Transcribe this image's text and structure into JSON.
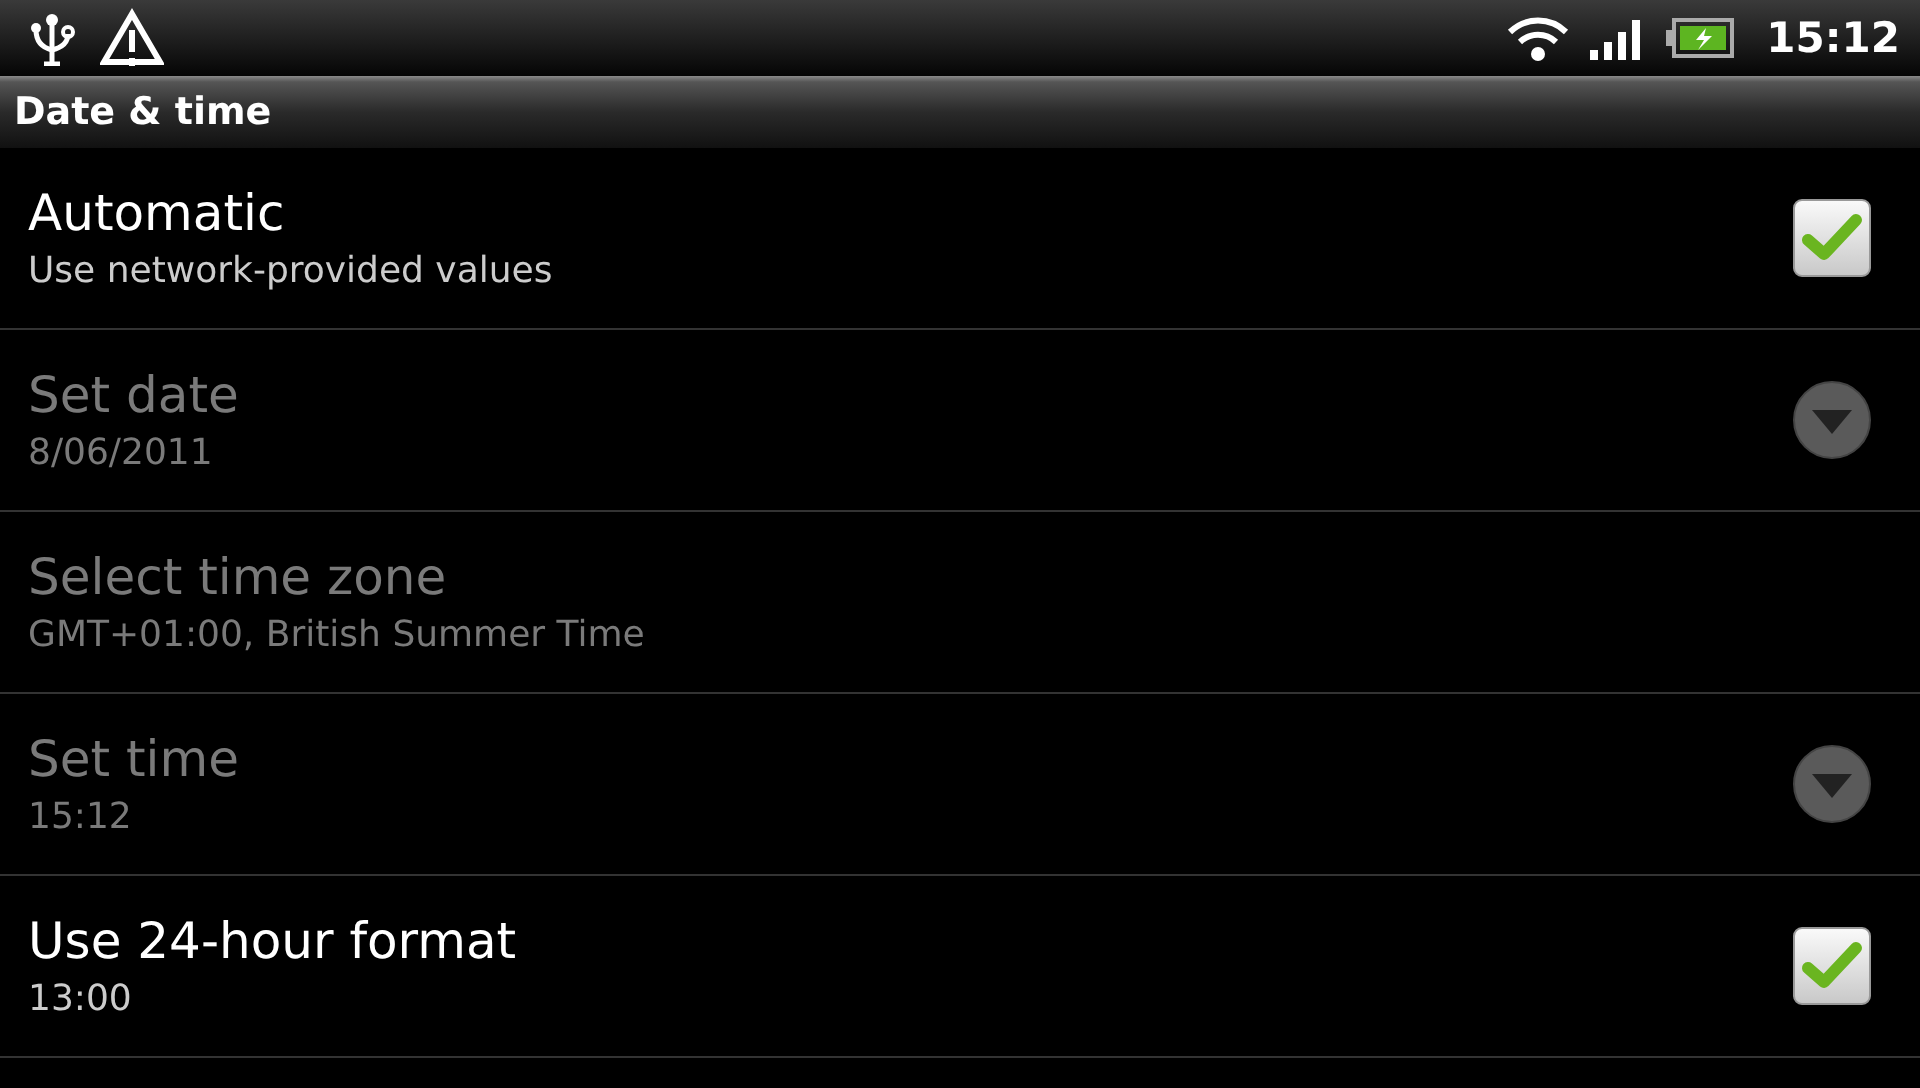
{
  "status_bar": {
    "time": "15:12"
  },
  "header": {
    "title": "Date & time"
  },
  "settings": [
    {
      "kind": "checkbox",
      "title": "Automatic",
      "summary": "Use network-provided values",
      "disabled": false,
      "checked": true
    },
    {
      "kind": "dropdown",
      "title": "Set date",
      "summary": "8/06/2011",
      "disabled": true
    },
    {
      "kind": "plain",
      "title": "Select time zone",
      "summary": "GMT+01:00, British Summer Time",
      "disabled": true
    },
    {
      "kind": "dropdown",
      "title": "Set time",
      "summary": "15:12",
      "disabled": true
    },
    {
      "kind": "checkbox",
      "title": "Use 24-hour format",
      "summary": "13:00",
      "disabled": false,
      "checked": true
    }
  ]
}
